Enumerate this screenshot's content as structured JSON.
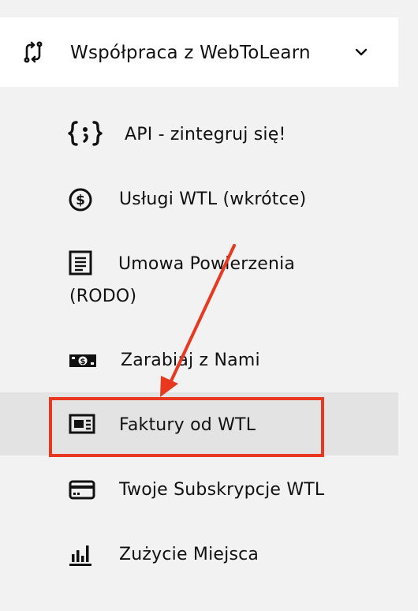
{
  "menu": {
    "header": {
      "title": "Współpraca z WebToLearn",
      "icon": "swap-arrows-icon",
      "expand_icon": "chevron-down-icon"
    },
    "items": [
      {
        "label": "API - zintegruj się!",
        "icon": "code-braces-icon",
        "active": false
      },
      {
        "label": "Usługi WTL (wkrótce)",
        "icon": "dollar-circle-icon",
        "active": false
      },
      {
        "label": "Umowa Powierzenia (RODO)",
        "icon": "document-icon",
        "active": false
      },
      {
        "label": "Zarabiaj z Nami",
        "icon": "cash-icon",
        "active": false
      },
      {
        "label": "Faktury od WTL",
        "icon": "invoice-icon",
        "active": true
      },
      {
        "label": "Twoje Subskrypcje WTL",
        "icon": "credit-card-icon",
        "active": false
      },
      {
        "label": "Zużycie Miejsca",
        "icon": "bar-chart-icon",
        "active": false
      }
    ]
  },
  "annotation": {
    "color": "#e8381f",
    "target": "Faktury od WTL"
  },
  "colors": {
    "background": "#f2f2f2",
    "header_bg": "#ffffff",
    "active_bg": "#e3e3e3",
    "text": "#111111"
  }
}
